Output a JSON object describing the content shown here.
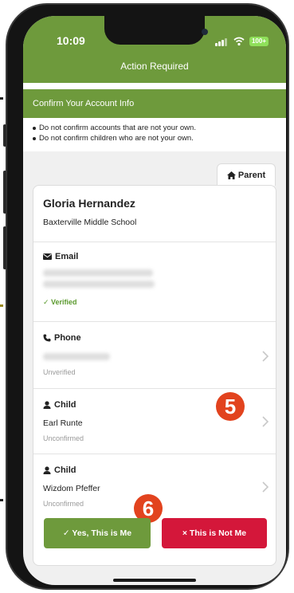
{
  "status_bar": {
    "time": "10:09",
    "battery": "100+"
  },
  "header": {
    "title": "Action Required"
  },
  "confirm_banner": {
    "title": "Confirm Your Account Info"
  },
  "warnings": [
    "Do not confirm accounts that are not your own.",
    "Do not confirm children who are not your own."
  ],
  "tab": {
    "label": "Parent",
    "icon": "home-icon"
  },
  "profile": {
    "name": "Gloria Hernandez",
    "school": "Baxterville Middle School"
  },
  "email": {
    "label": "Email",
    "icon": "envelope-icon",
    "status": "✓ Verified"
  },
  "phone": {
    "label": "Phone",
    "icon": "phone-icon",
    "status": "Unverified"
  },
  "children": [
    {
      "label": "Child",
      "name": "Earl Runte",
      "status": "Unconfirmed"
    },
    {
      "label": "Child",
      "name": "Wizdom Pfeffer",
      "status": "Unconfirmed"
    }
  ],
  "callouts": {
    "five": "5",
    "six": "6"
  },
  "buttons": {
    "yes": "✓ Yes, This is Me",
    "no": "× This is Not Me"
  },
  "colors": {
    "brand_green": "#6e9a3c",
    "danger_red": "#d4173a",
    "callout_orange": "#e2431e",
    "verified_green": "#5b9a2e"
  }
}
